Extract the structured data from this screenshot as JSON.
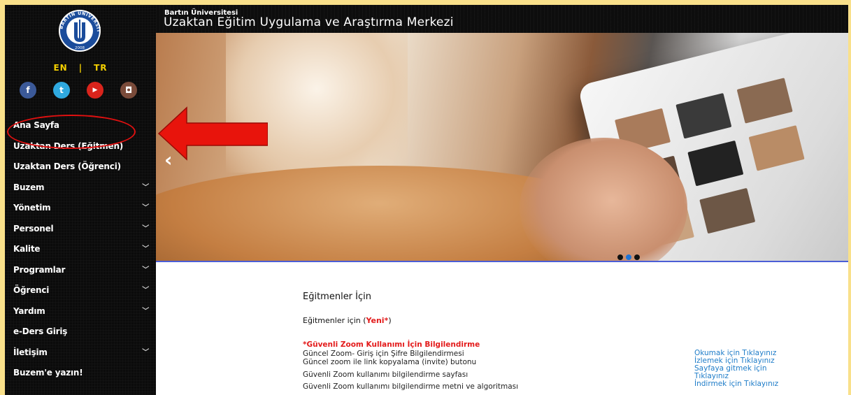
{
  "header": {
    "subtitle": "Bartın Üniversitesi",
    "title": "Uzaktan Eğitim Uygulama ve Araştırma Merkezi"
  },
  "logo": {
    "ring_text": "BARTIN ÜNİVERSİTESİ",
    "year": "2008"
  },
  "lang": {
    "en": "EN",
    "sep": "|",
    "tr": "TR"
  },
  "socials": [
    {
      "name": "facebook",
      "glyph": "f",
      "color": "#3b5998"
    },
    {
      "name": "twitter",
      "glyph": "t",
      "color": "#2fa9e0"
    },
    {
      "name": "youtube",
      "glyph": "▶",
      "color": "#d9241c"
    },
    {
      "name": "instagram",
      "glyph": "◘",
      "color": "#7a4b3a"
    }
  ],
  "nav": [
    {
      "label": "Ana Sayfa",
      "chevron": false
    },
    {
      "label": "Uzaktan Ders (Eğitmen)",
      "chevron": false
    },
    {
      "label": "Uzaktan Ders (Öğrenci)",
      "chevron": false
    },
    {
      "label": "Buzem",
      "chevron": true
    },
    {
      "label": "Yönetim",
      "chevron": true
    },
    {
      "label": "Personel",
      "chevron": true
    },
    {
      "label": "Kalite",
      "chevron": true
    },
    {
      "label": "Programlar",
      "chevron": true
    },
    {
      "label": "Öğrenci",
      "chevron": true
    },
    {
      "label": "Yardım",
      "chevron": true
    },
    {
      "label": "e-Ders Giriş",
      "chevron": false
    },
    {
      "label": "İletişim",
      "chevron": true
    },
    {
      "label": "Buzem'e yazın!",
      "chevron": false
    }
  ],
  "slider": {
    "prev": "‹",
    "active_dot": 1,
    "dot_count": 3
  },
  "content": {
    "title": "Eğitmenler İçin",
    "subtitle_prefix": "Eğitmenler için (",
    "subtitle_new": "Yeni*",
    "subtitle_suffix": ")",
    "lines": [
      "*Güvenli Zoom Kullanımı İçin Bilgilendirme",
      "Güncel Zoom- Giriş için Şifre Bilgilendirmesi",
      "Güncel zoom ile link kopyalama (invite) butonu",
      "Güvenli Zoom kullanımı bilgilendirme sayfası",
      "Güvenli Zoom kullanımı bilgilendirme metni ve algoritması"
    ],
    "links": [
      "Okumak için Tıklayınız",
      "İzlemek için Tıklayınız",
      "Sayfaya gitmek için",
      "Tıklayınız",
      "İndirmek için Tıklayınız"
    ]
  },
  "colors": {
    "sidebar_bg": "#0b0b0b",
    "accent_yellow": "#f4d000",
    "annotation_red": "#e01010",
    "link_blue": "#1e7cc8",
    "slider_bar": "#4b5ed6"
  }
}
